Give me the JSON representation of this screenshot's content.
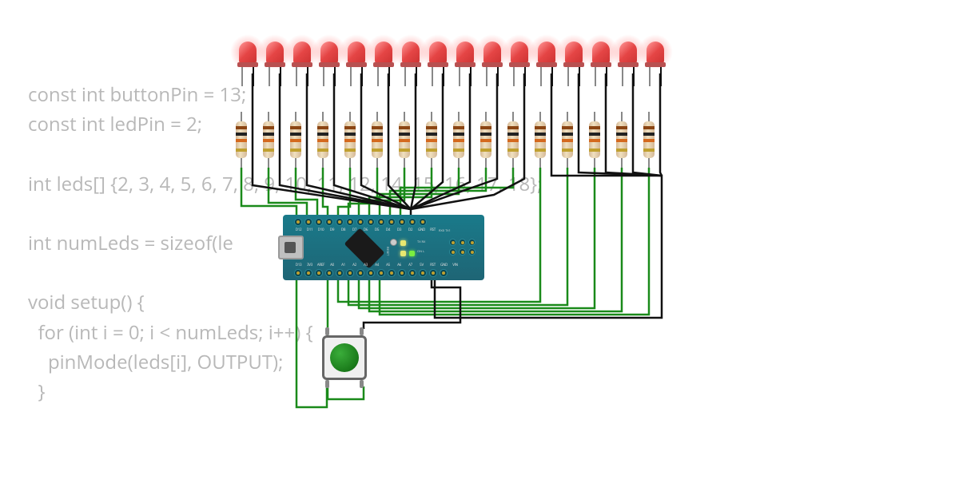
{
  "code": {
    "line1": "const int buttonPin = 13;",
    "line2": "const int ledPin = 2;",
    "line3": "",
    "line4": "int leds[] {2, 3, 4, 5, 6, 7, 8, 9, 10, 11, 12, 14, 15, 16, 17, 18};",
    "line5": "",
    "line6": "int numLeds = sizeof(le",
    "line7": "",
    "line8": "void setup() {",
    "line9": "  for (int i = 0; i < numLeds; i++) {",
    "line10": "    pinMode(leds[i], OUTPUT);",
    "line11": "  }"
  },
  "board": {
    "name": "Arduino Nano",
    "pins_top": [
      "D12",
      "D11",
      "D10",
      "D9",
      "D8",
      "D7",
      "D6",
      "D5",
      "D4",
      "D3",
      "D2",
      "GND",
      "RST"
    ],
    "pins_bottom": [
      "D13",
      "3V3",
      "AREF",
      "A0",
      "A1",
      "A2",
      "A3",
      "A4",
      "A5",
      "A6",
      "A7",
      "5V",
      "RST",
      "GND",
      "VIN"
    ],
    "labels": {
      "reset": "RESET",
      "tx_rx": "TX RX",
      "on_l": "ON L",
      "rx_tx": "RX0 TX1"
    }
  },
  "components": {
    "led_count": 16,
    "led_color": "#e54545",
    "resistor_bands": [
      "brown",
      "black",
      "orange",
      "gold"
    ],
    "button_color": "#1a7a1a"
  },
  "wires": {
    "signal_color": "#1a8a1a",
    "ground_color": "#111111"
  }
}
